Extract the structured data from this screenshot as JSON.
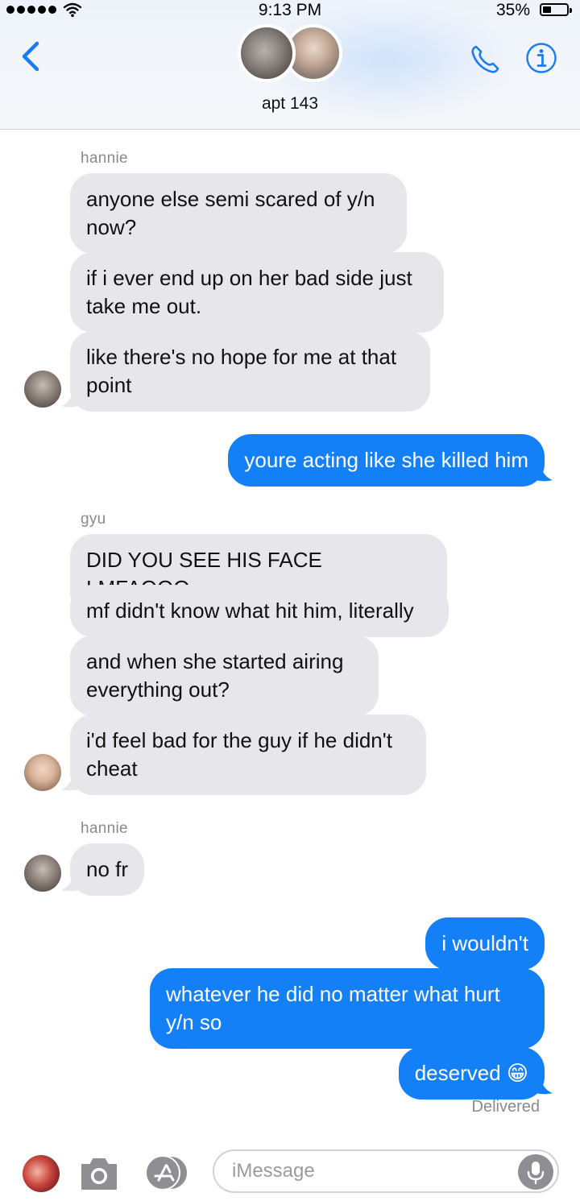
{
  "status_bar": {
    "time": "9:13 PM",
    "battery_percent": "35%",
    "battery_level": 0.35
  },
  "header": {
    "group_name": "apt 143",
    "back_icon": "chevron-left-icon",
    "call_icon": "phone-icon",
    "info_icon": "info-icon"
  },
  "messages": [
    {
      "sender": "hannie",
      "text": "anyone else semi scared of y/n now?"
    },
    {
      "text": "if i ever end up on her bad side just take me out."
    },
    {
      "text": "like there's no hope for me at that point"
    },
    {
      "text": "youre acting like she killed him"
    },
    {
      "sender": "gyu",
      "text": "DID YOU SEE HIS FACE LMFAOOO"
    },
    {
      "text": "mf didn't know what hit him, literally"
    },
    {
      "text": "and when she started airing everything out?"
    },
    {
      "text": "i'd feel bad for the guy if he didn't cheat"
    },
    {
      "sender": "hannie",
      "text": "no fr"
    },
    {
      "text": "i wouldn't"
    },
    {
      "text": "whatever he did no matter what hurt y/n so"
    },
    {
      "text": "deserved 😁"
    }
  ],
  "delivery_status": "Delivered",
  "composer": {
    "placeholder": "iMessage",
    "value": ""
  },
  "colors": {
    "outgoing_bubble": "#1480f7",
    "incoming_bubble": "#e6e6eb",
    "accent": "#1a7cf4"
  }
}
